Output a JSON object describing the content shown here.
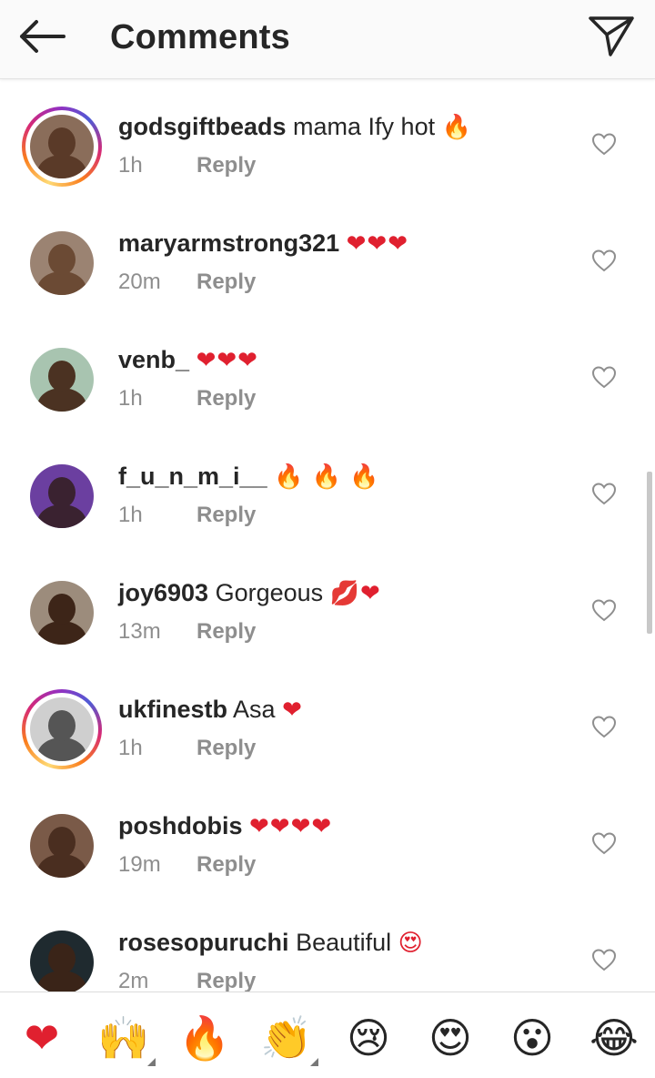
{
  "header": {
    "title": "Comments",
    "back_icon": "arrow-left-icon",
    "share_icon": "paper-plane-icon"
  },
  "colors": {
    "heart": "#e0202f",
    "text": "#262626",
    "meta": "#8e8e8e"
  },
  "comments": [
    {
      "username": "godsgiftbeads",
      "text": "mama Ify hot",
      "emoji": "🔥",
      "time": "1h",
      "reply": "Reply",
      "story_ring": true,
      "face": "#5a3a28",
      "bg": "#8a6d5a"
    },
    {
      "username": "maryarmstrong321",
      "text": "",
      "emoji": "❤❤❤",
      "time": "20m",
      "reply": "Reply",
      "story_ring": false,
      "face": "#6b4a34",
      "bg": "#9b8372"
    },
    {
      "username": "venb_",
      "text": "",
      "emoji": "❤❤❤",
      "time": "1h",
      "reply": "Reply",
      "story_ring": false,
      "face": "#4b3222",
      "bg": "#a8c4b0"
    },
    {
      "username": "f_u_n_m_i__",
      "text": "",
      "emoji": "🔥 🔥 🔥",
      "time": "1h",
      "reply": "Reply",
      "story_ring": false,
      "face": "#3a2230",
      "bg": "#6b3fa0"
    },
    {
      "username": "joy6903",
      "text": "Gorgeous",
      "emoji": "💋❤",
      "time": "13m",
      "reply": "Reply",
      "story_ring": false,
      "face": "#3d2518",
      "bg": "#9c8c7c"
    },
    {
      "username": "ukfinestb",
      "text": "Asa",
      "emoji": "❤",
      "time": "1h",
      "reply": "Reply",
      "story_ring": true,
      "face": "#555555",
      "bg": "#cfcfcf"
    },
    {
      "username": "poshdobis",
      "text": "",
      "emoji": "❤❤❤❤",
      "time": "19m",
      "reply": "Reply",
      "story_ring": false,
      "face": "#4a2e20",
      "bg": "#7a5a48"
    },
    {
      "username": "rosesopuruchi",
      "text": "Beautiful",
      "emoji": "😍",
      "time": "2m",
      "reply": "Reply",
      "story_ring": false,
      "face": "#3a2418",
      "bg": "#1f2a2f"
    }
  ],
  "quick_reactions": [
    "❤",
    "🙌",
    "🔥",
    "👏",
    "😢",
    "😍",
    "😮",
    "😂"
  ]
}
